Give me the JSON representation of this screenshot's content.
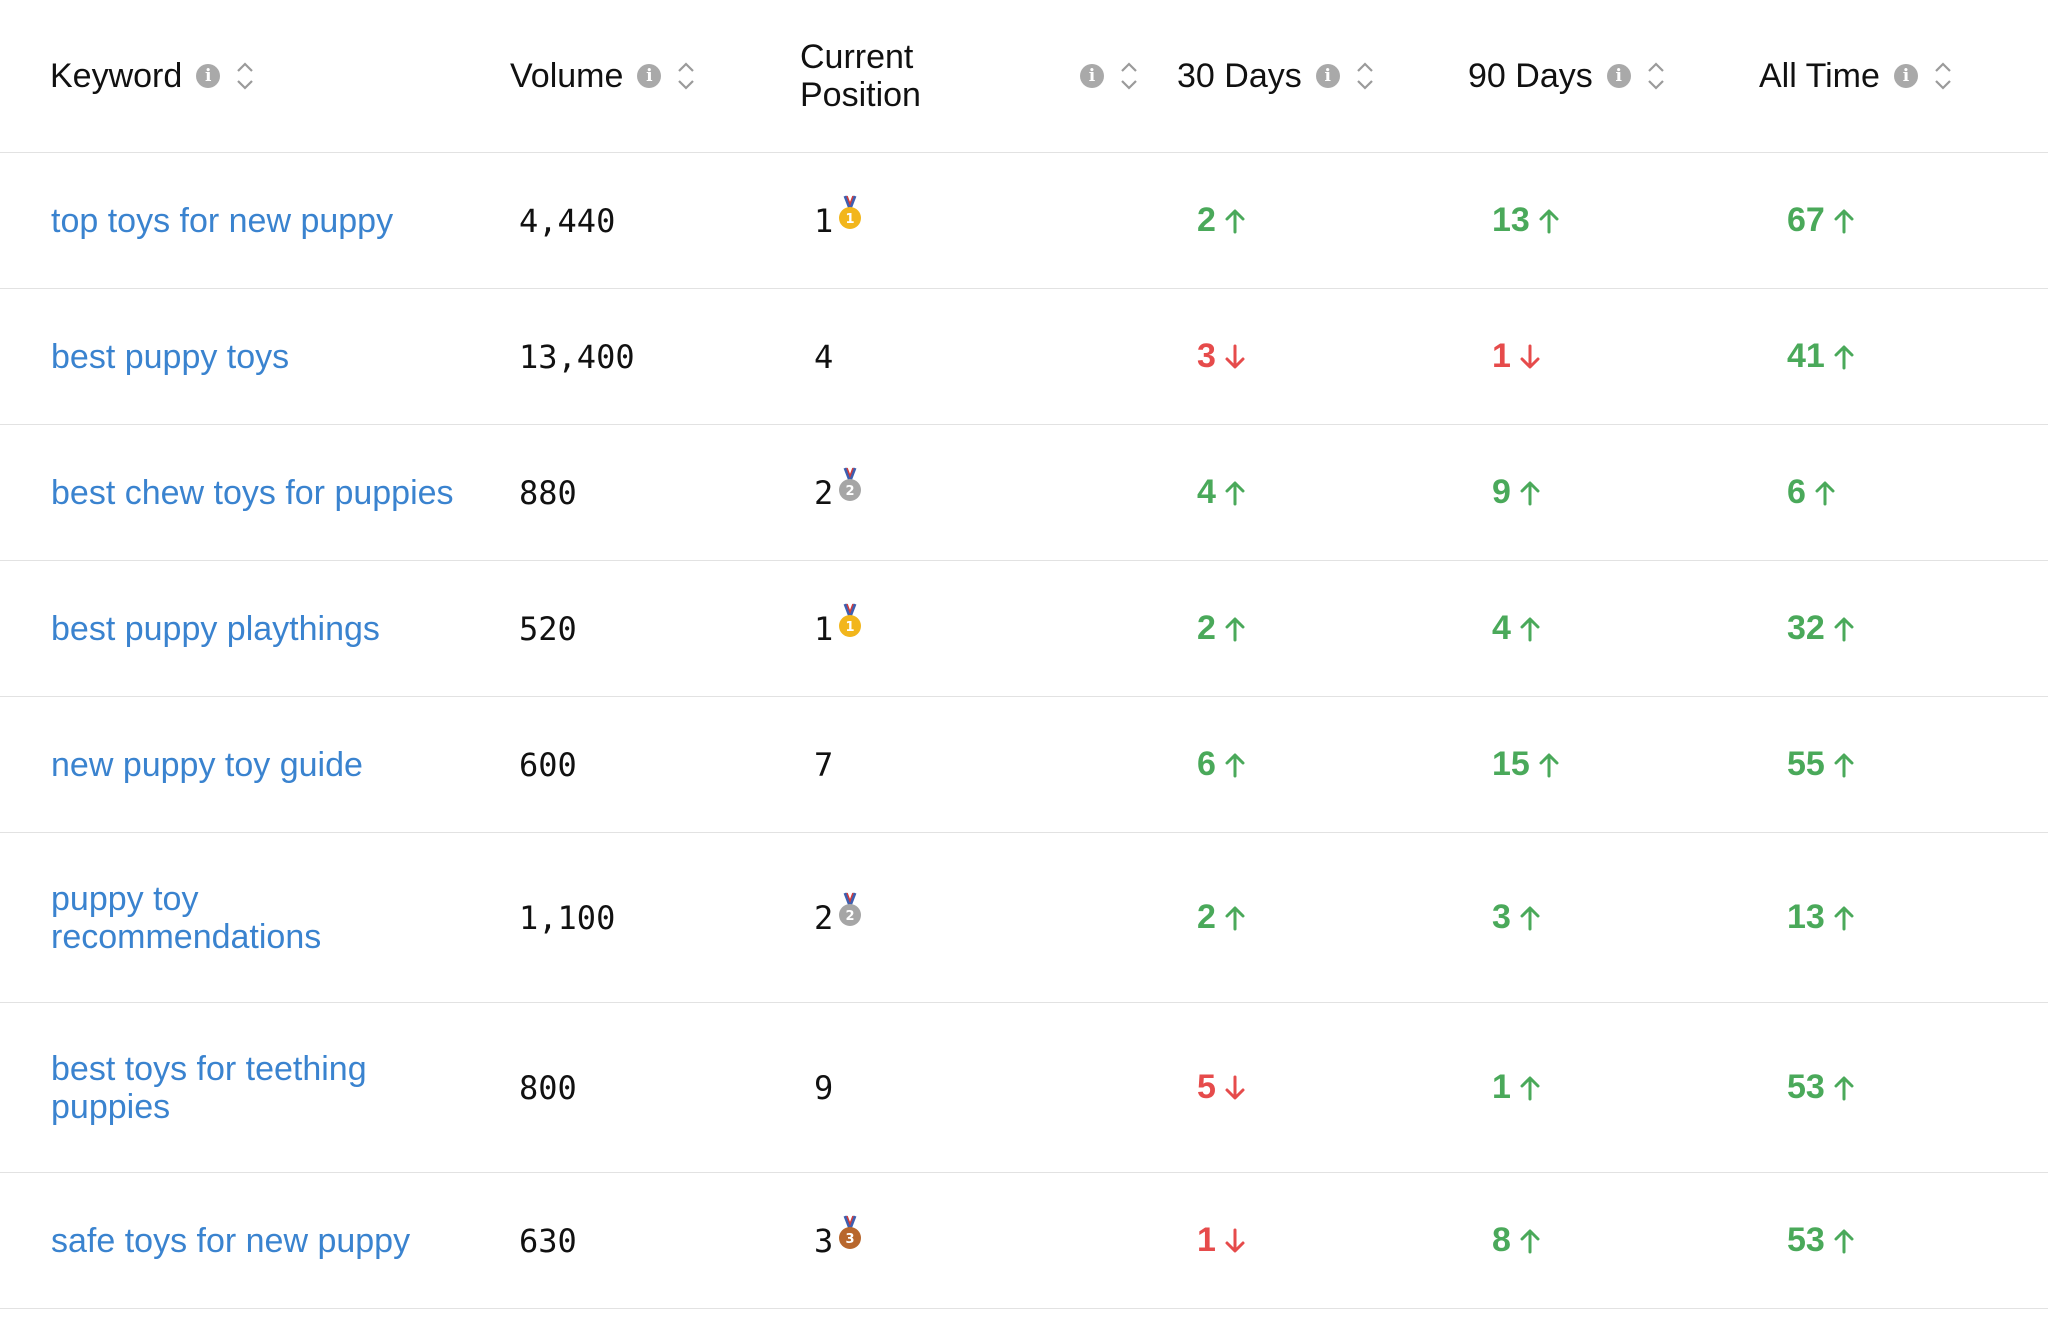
{
  "columns": [
    {
      "key": "keyword",
      "label": "Keyword"
    },
    {
      "key": "volume",
      "label": "Volume"
    },
    {
      "key": "position",
      "label_line1": "Current",
      "label_line2": "Position"
    },
    {
      "key": "d30",
      "label": "30 Days"
    },
    {
      "key": "d90",
      "label": "90 Days"
    },
    {
      "key": "all",
      "label": "All Time"
    }
  ],
  "colors": {
    "link": "#3a83cf",
    "up": "#4aa95a",
    "down": "#e64b4b",
    "gold": "#f2b61c",
    "silver": "#a6a6a6",
    "bronze": "#b8672d"
  },
  "rows": [
    {
      "keyword": "top toys for new puppy",
      "volume": "4,440",
      "position": "1",
      "medal": "gold",
      "d30": {
        "value": "2",
        "dir": "up"
      },
      "d90": {
        "value": "13",
        "dir": "up"
      },
      "all": {
        "value": "67",
        "dir": "up"
      }
    },
    {
      "keyword": "best puppy toys",
      "volume": "13,400",
      "position": "4",
      "medal": "",
      "d30": {
        "value": "3",
        "dir": "down"
      },
      "d90": {
        "value": "1",
        "dir": "down"
      },
      "all": {
        "value": "41",
        "dir": "up"
      }
    },
    {
      "keyword": "best chew toys for puppies",
      "volume": "880",
      "position": "2",
      "medal": "silver",
      "d30": {
        "value": "4",
        "dir": "up"
      },
      "d90": {
        "value": "9",
        "dir": "up"
      },
      "all": {
        "value": "6",
        "dir": "up"
      }
    },
    {
      "keyword": "best puppy playthings",
      "volume": "520",
      "position": "1",
      "medal": "gold",
      "d30": {
        "value": "2",
        "dir": "up"
      },
      "d90": {
        "value": "4",
        "dir": "up"
      },
      "all": {
        "value": "32",
        "dir": "up"
      }
    },
    {
      "keyword": "new puppy toy guide",
      "volume": "600",
      "position": "7",
      "medal": "",
      "d30": {
        "value": "6",
        "dir": "up"
      },
      "d90": {
        "value": "15",
        "dir": "up"
      },
      "all": {
        "value": "55",
        "dir": "up"
      }
    },
    {
      "keyword_line1": "puppy toy",
      "keyword_line2": "recommendations",
      "volume": "1,100",
      "position": "2",
      "medal": "silver",
      "d30": {
        "value": "2",
        "dir": "up"
      },
      "d90": {
        "value": "3",
        "dir": "up"
      },
      "all": {
        "value": "13",
        "dir": "up"
      }
    },
    {
      "keyword_line1": "best toys for teething",
      "keyword_line2": "puppies",
      "volume": "800",
      "position": "9",
      "medal": "",
      "d30": {
        "value": "5",
        "dir": "down"
      },
      "d90": {
        "value": "1",
        "dir": "up"
      },
      "all": {
        "value": "53",
        "dir": "up"
      }
    },
    {
      "keyword": "safe toys for new puppy",
      "volume": "630",
      "position": "3",
      "medal": "bronze",
      "d30": {
        "value": "1",
        "dir": "down"
      },
      "d90": {
        "value": "8",
        "dir": "up"
      },
      "all": {
        "value": "53",
        "dir": "up"
      }
    }
  ]
}
